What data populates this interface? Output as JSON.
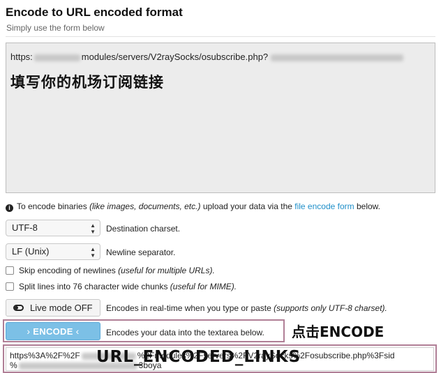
{
  "header": {
    "title": "Encode to URL encoded format",
    "subtitle": "Simply use the form below"
  },
  "input": {
    "prefix": "https:",
    "middle": "modules/servers/V2raySocks/osubscribe.php?",
    "annotation": "填写你的机场订阅链接"
  },
  "info": {
    "before": "To encode binaries ",
    "italic": "(like images, documents, etc.)",
    "middle": " upload your data via the ",
    "link": "file encode form",
    "after": " below."
  },
  "charset": {
    "value": "UTF-8",
    "label": "Destination charset."
  },
  "newline": {
    "value": "LF (Unix)",
    "label": "Newline separator."
  },
  "options": {
    "skip_label": "Skip encoding of newlines ",
    "skip_hint": "(useful for multiple URLs).",
    "split_label": "Split lines into 76 character wide chunks ",
    "split_hint": "(useful for MIME)."
  },
  "live": {
    "button": "Live mode OFF",
    "text": "Encodes in real-time when you type or paste ",
    "hint": "(supports only UTF-8 charset)."
  },
  "encode": {
    "chev_left": "›",
    "button": "ENCODE",
    "chev_right": "‹",
    "text": "Encodes your data into the textarea below.",
    "annotation": "点击ENCODE"
  },
  "output": {
    "line1_start": "https%3A%2F%2F",
    "line1_end": "%2Fmodules%2Fservers%2FV2raySocks%2Fosubscribe.php%3Fsid",
    "line2_start": "%",
    "line2_end": "3boya",
    "annotation": "URL_ENCODED_LINKS"
  },
  "colors": {
    "encode_button": "#7cc0e6",
    "link": "#1f8fc9",
    "highlight_box": "#b07f96"
  }
}
